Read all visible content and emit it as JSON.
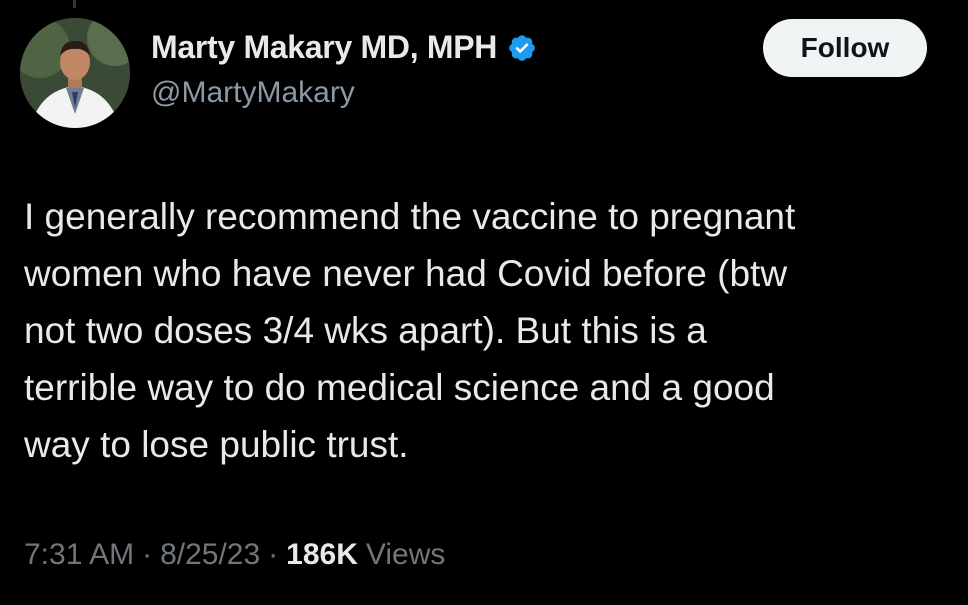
{
  "author": {
    "display_name": "Marty Makary MD, MPH",
    "handle": "@MartyMakary",
    "verified": true,
    "verified_color": "#1d9bf0"
  },
  "actions": {
    "follow_label": "Follow"
  },
  "tweet": {
    "text": "I generally recommend the vaccine to pregnant\nwomen who have never had Covid before (btw\nnot two doses 3/4 wks apart). But this is a\nterrible way to do medical science and a good\nway to lose public trust."
  },
  "meta": {
    "time": "7:31 AM",
    "separator": "·",
    "date": "8/25/23",
    "views_count": "186K",
    "views_label": "Views"
  },
  "theme": {
    "background": "#000000",
    "text_primary": "#e7e9ea",
    "text_secondary": "#71767b",
    "button_bg": "#eff3f4"
  }
}
